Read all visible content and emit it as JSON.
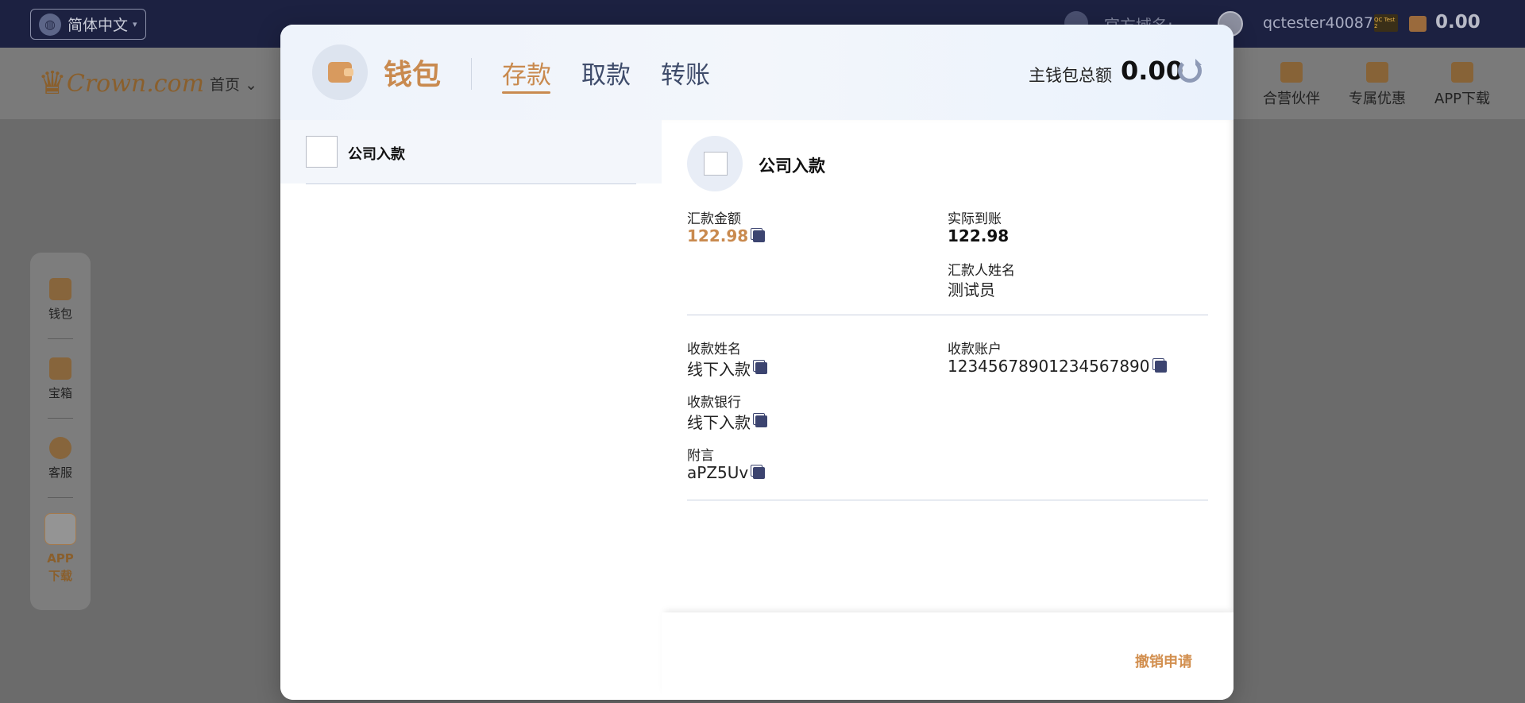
{
  "topbar": {
    "language": "简体中文",
    "domain_label": "官方域名:",
    "username": "qctester400870",
    "vip_badge": "QC Test 2",
    "balance": "0.00"
  },
  "navbar": {
    "logo_text": "Crown.com",
    "logo_cn": "皇冠",
    "home": "首页",
    "right_items": [
      "合营伙伴",
      "专属优惠",
      "APP下载"
    ]
  },
  "dock": {
    "items": [
      "钱包",
      "宝箱",
      "客服"
    ],
    "app_line1": "APP",
    "app_line2": "下载"
  },
  "modal": {
    "title": "钱包",
    "tabs": [
      "存款",
      "取款",
      "转账"
    ],
    "active_tab": "存款",
    "balance_label": "主钱包总额",
    "balance_value": "0.00",
    "methods": [
      {
        "label": "公司入款"
      }
    ],
    "detail": {
      "title": "公司入款",
      "amount_label": "汇款金额",
      "amount_value": "122.98",
      "actual_label": "实际到账",
      "actual_value": "122.98",
      "remitter_label": "汇款人姓名",
      "remitter_value": "测试员",
      "payee_name_label": "收款姓名",
      "payee_name_value": "线下入款",
      "payee_account_label": "收款账户",
      "payee_account_value": "12345678901234567890",
      "payee_bank_label": "收款银行",
      "payee_bank_value": "线下入款",
      "memo_label": "附言",
      "memo_value": "aPZ5Uv"
    },
    "cancel_label": "撤销申请"
  }
}
